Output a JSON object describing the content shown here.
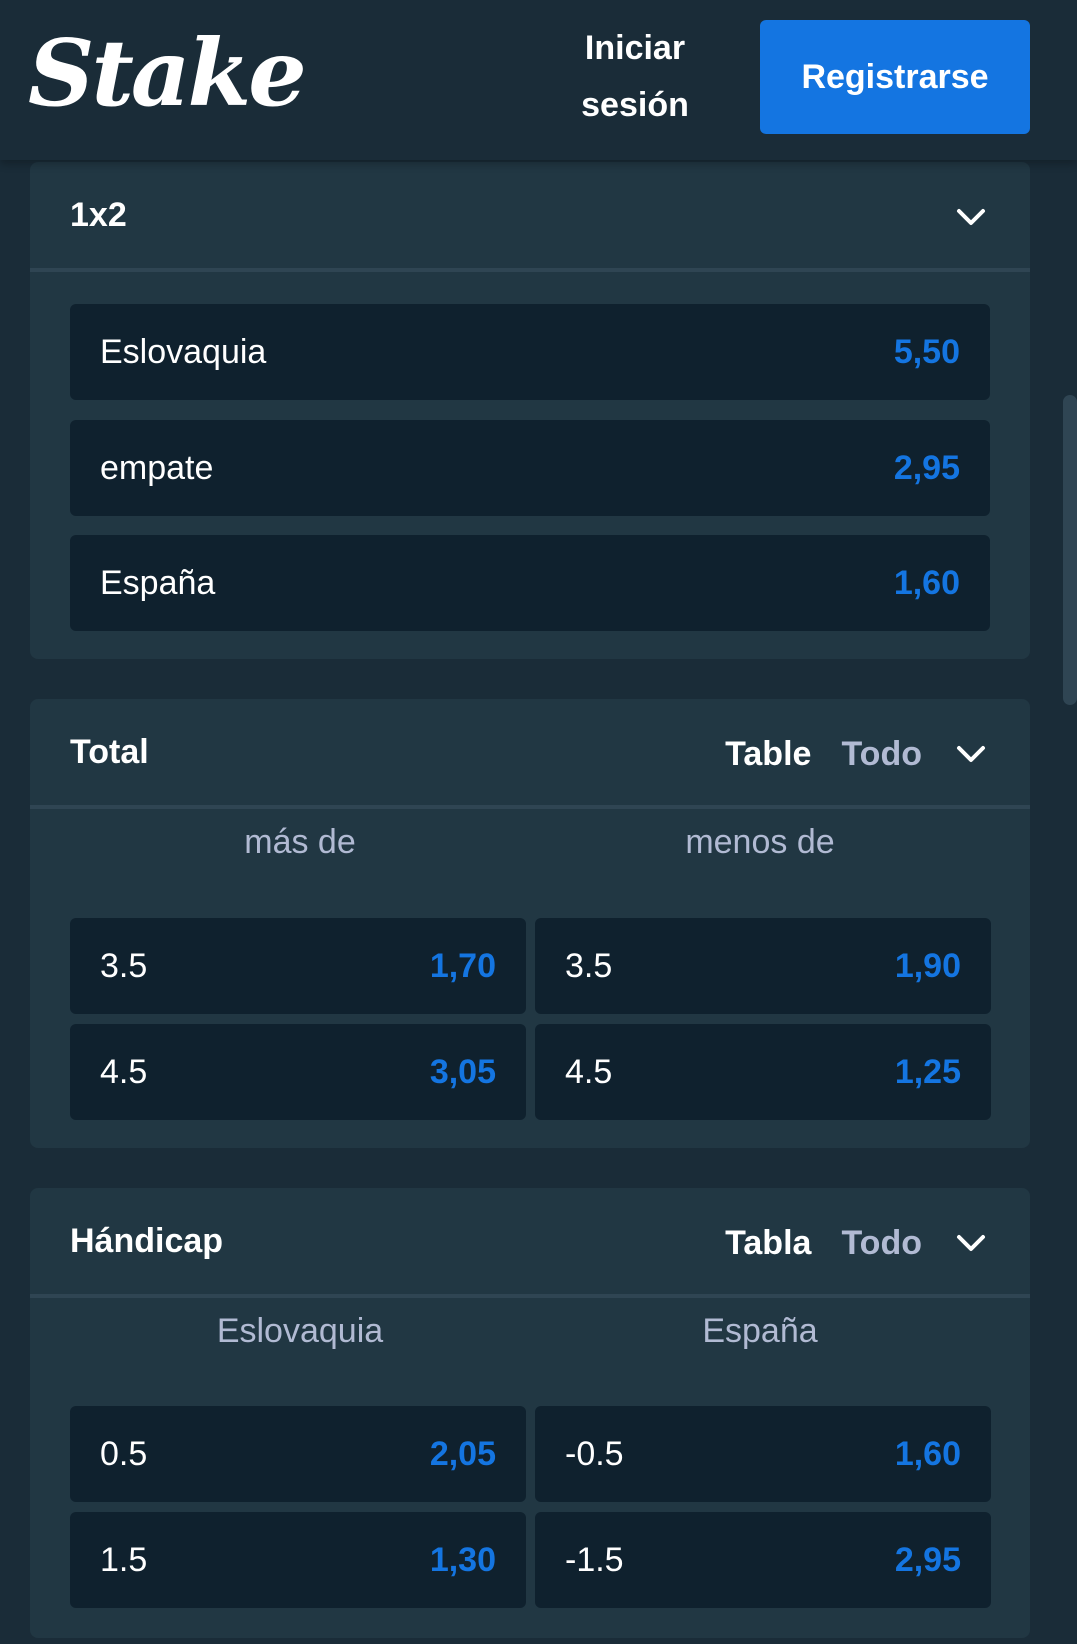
{
  "header": {
    "logo": "Stake",
    "login_label": "Iniciar\nsesión",
    "register_label": "Registrarse"
  },
  "markets": {
    "one_x_two": {
      "title": "1x2",
      "outcomes": [
        {
          "label": "Eslovaquia",
          "odds": "5,50"
        },
        {
          "label": "empate",
          "odds": "2,95"
        },
        {
          "label": "España",
          "odds": "1,60"
        }
      ]
    },
    "total": {
      "title": "Total",
      "view_table": "Table",
      "view_all": "Todo",
      "columns": [
        "más de",
        "menos de"
      ],
      "rows": [
        {
          "over_line": "3.5",
          "over_odds": "1,70",
          "under_line": "3.5",
          "under_odds": "1,90"
        },
        {
          "over_line": "4.5",
          "over_odds": "3,05",
          "under_line": "4.5",
          "under_odds": "1,25"
        }
      ]
    },
    "handicap": {
      "title": "Hándicap",
      "view_table": "Tabla",
      "view_all": "Todo",
      "columns": [
        "Eslovaquia",
        "España"
      ],
      "rows": [
        {
          "home_line": "0.5",
          "home_odds": "2,05",
          "away_line": "-0.5",
          "away_odds": "1,60"
        },
        {
          "home_line": "1.5",
          "home_odds": "1,30",
          "away_line": "-1.5",
          "away_odds": "2,95"
        }
      ]
    }
  },
  "colors": {
    "background": "#1a2c38",
    "card": "#213743",
    "odds_button": "#0f212e",
    "accent_blue": "#1475e1",
    "muted_text": "#b1bad3"
  },
  "icons": {
    "collapse": "chevron-down-icon"
  }
}
